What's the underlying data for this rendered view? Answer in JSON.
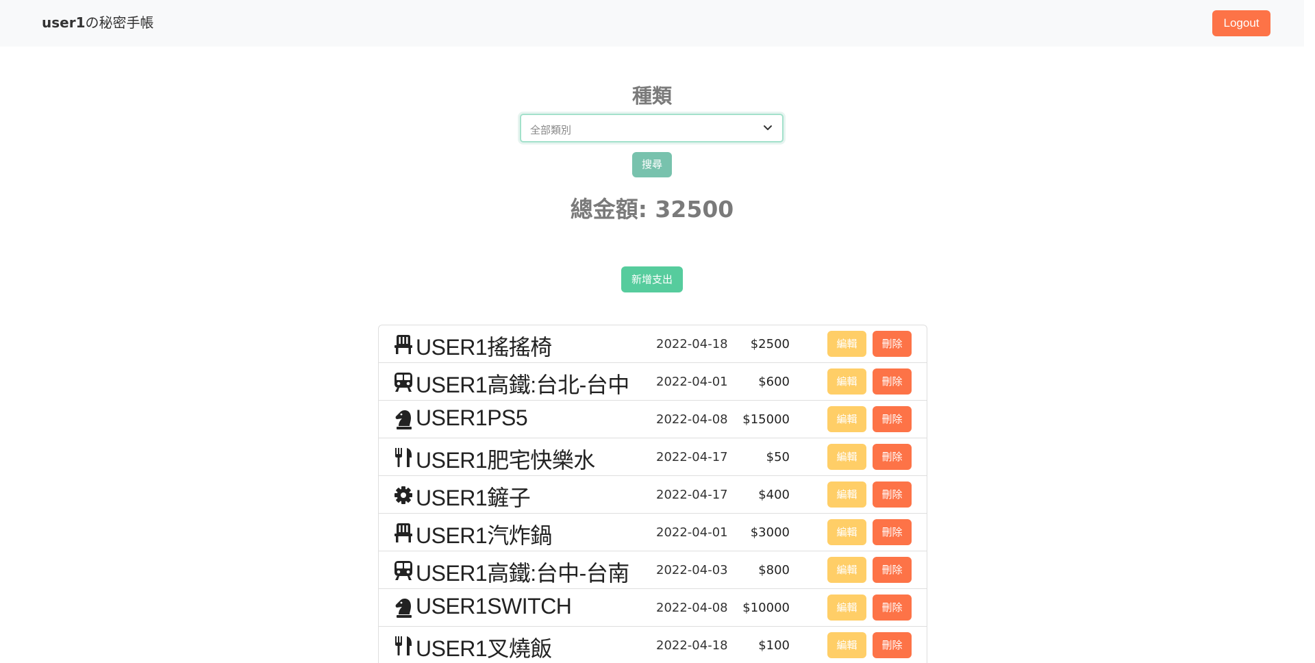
{
  "navbar": {
    "brand_user": "user1",
    "brand_suffix": "の秘密手帳",
    "logout_label": "Logout"
  },
  "filter": {
    "title": "種類",
    "category_value": "全部類別",
    "search_label": "搜尋"
  },
  "total_label": "總金額: 32500",
  "add_label": "新增支出",
  "expenses": [
    {
      "icon": "chair-icon",
      "name": "USER1搖搖椅",
      "date": "2022-04-18",
      "amount": "$2500",
      "edit_label": "編輯",
      "delete_label": "刪除"
    },
    {
      "icon": "train-icon",
      "name": "USER1高鐵:台北-台中",
      "date": "2022-04-01",
      "amount": "$600",
      "edit_label": "編輯",
      "delete_label": "刪除"
    },
    {
      "icon": "chess-knight-icon",
      "name": "USER1PS5",
      "date": "2022-04-08",
      "amount": "$15000",
      "edit_label": "編輯",
      "delete_label": "刪除"
    },
    {
      "icon": "utensils-icon",
      "name": "USER1肥宅快樂水",
      "date": "2022-04-17",
      "amount": "$50",
      "edit_label": "編輯",
      "delete_label": "刪除"
    },
    {
      "icon": "gear-icon",
      "name": "USER1鏟子",
      "date": "2022-04-17",
      "amount": "$400",
      "edit_label": "編輯",
      "delete_label": "刪除"
    },
    {
      "icon": "chair-icon",
      "name": "USER1汽炸鍋",
      "date": "2022-04-01",
      "amount": "$3000",
      "edit_label": "編輯",
      "delete_label": "刪除"
    },
    {
      "icon": "train-icon",
      "name": "USER1高鐵:台中-台南",
      "date": "2022-04-03",
      "amount": "$800",
      "edit_label": "編輯",
      "delete_label": "刪除"
    },
    {
      "icon": "chess-knight-icon",
      "name": "USER1SWITCH",
      "date": "2022-04-08",
      "amount": "$10000",
      "edit_label": "編輯",
      "delete_label": "刪除"
    },
    {
      "icon": "utensils-icon",
      "name": "USER1叉燒飯",
      "date": "2022-04-18",
      "amount": "$100",
      "edit_label": "編輯",
      "delete_label": "刪除"
    }
  ],
  "colors": {
    "navbar_bg": "#f8f9fa",
    "danger": "#fd7347",
    "warning": "#ffce67",
    "primary": "#78c2ad",
    "success": "#56cc9d"
  }
}
